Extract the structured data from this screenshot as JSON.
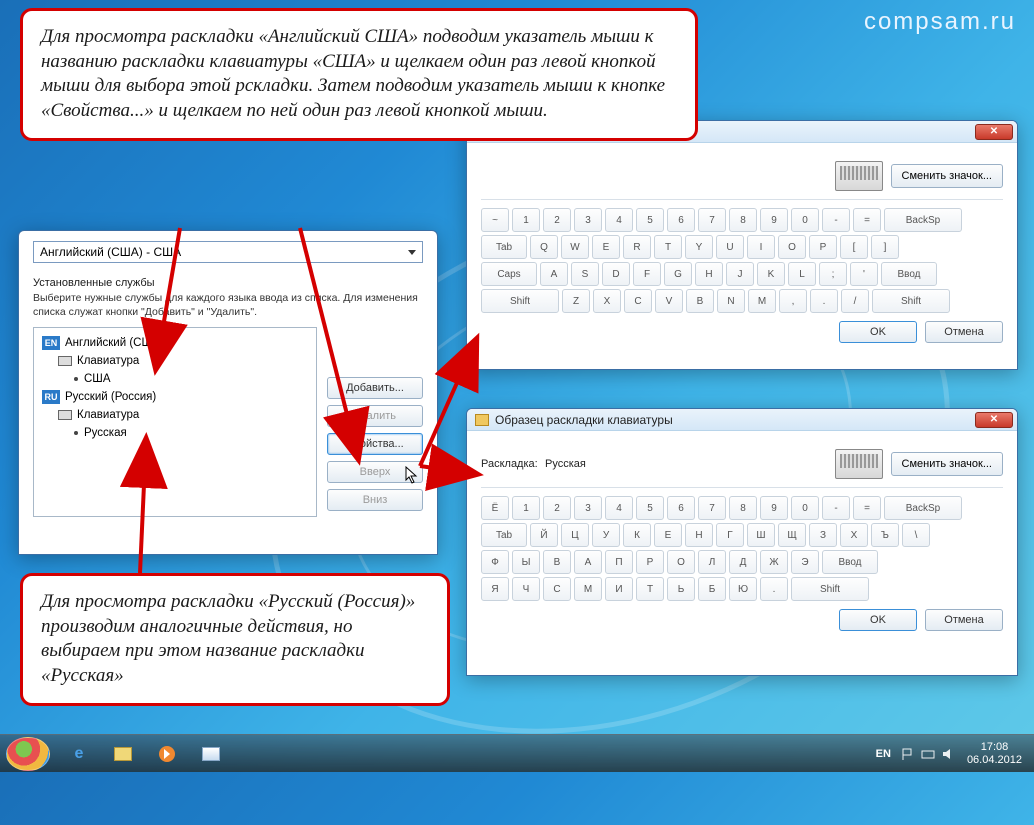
{
  "watermark": "compsam.ru",
  "instructions": {
    "top": "Для просмотра раскладки «Английский США» подводим указатель мыши к названию раскладки клавиатуры «США» и щелкаем один раз левой кнопкой мыши для выбора этой рскладки. Затем подводим указатель мыши к кнопке «Свойства...» и щелкаем по ней один раз левой кнопкой мыши.",
    "bottom": "Для просмотра раскладки «Русский (Россия)» производим аналогичные действия, но выбираем при этом название раскладки «Русская»"
  },
  "leftDialog": {
    "defaultLang": "Английский (США) - США",
    "groupLabel": "Установленные службы",
    "hint": "Выберите нужные службы для каждого языка ввода из списка. Для изменения списка служат кнопки \"Добавить\" и \"Удалить\".",
    "tree": {
      "en_lang": "Английский (США)",
      "en_kb": "Клавиатура",
      "en_layout": "США",
      "ru_lang": "Русский (Россия)",
      "ru_kb": "Клавиатура",
      "ru_layout": "Русская"
    },
    "buttons": {
      "add": "Добавить...",
      "remove": "Удалить",
      "props": "Свойства...",
      "up": "Вверх",
      "down": "Вниз"
    }
  },
  "kbSample": {
    "title": "Образец раскладки клавиатуры",
    "layoutLabel": "Раскладка:",
    "changeIcon": "Сменить значок...",
    "ok": "OK",
    "cancel": "Отмена"
  },
  "kb1": {
    "layoutName": "",
    "rows": [
      [
        "~",
        "1",
        "2",
        "3",
        "4",
        "5",
        "6",
        "7",
        "8",
        "9",
        "0",
        "-",
        "=",
        "BackSp"
      ],
      [
        "Tab",
        "Q",
        "W",
        "E",
        "R",
        "T",
        "Y",
        "U",
        "I",
        "O",
        "P",
        "[",
        "]"
      ],
      [
        "Caps",
        "A",
        "S",
        "D",
        "F",
        "G",
        "H",
        "J",
        "K",
        "L",
        ";",
        "'",
        "Ввод"
      ],
      [
        "Shift",
        "Z",
        "X",
        "C",
        "V",
        "B",
        "N",
        "M",
        ",",
        ".",
        "/",
        "Shift"
      ]
    ]
  },
  "kb2": {
    "layoutName": "Русская",
    "rows": [
      [
        "Ё",
        "1",
        "2",
        "3",
        "4",
        "5",
        "6",
        "7",
        "8",
        "9",
        "0",
        "-",
        "=",
        "BackSp"
      ],
      [
        "Tab",
        "Й",
        "Ц",
        "У",
        "К",
        "Е",
        "Н",
        "Г",
        "Ш",
        "Щ",
        "З",
        "Х",
        "Ъ",
        "\\"
      ],
      [
        "Ф",
        "Ы",
        "В",
        "А",
        "П",
        "Р",
        "О",
        "Л",
        "Д",
        "Ж",
        "Э",
        "Ввод"
      ],
      [
        "Я",
        "Ч",
        "С",
        "М",
        "И",
        "Т",
        "Ь",
        "Б",
        "Ю",
        ".",
        "Shift"
      ]
    ]
  },
  "taskbar": {
    "lang": "EN",
    "time": "17:08",
    "date": "06.04.2012"
  }
}
